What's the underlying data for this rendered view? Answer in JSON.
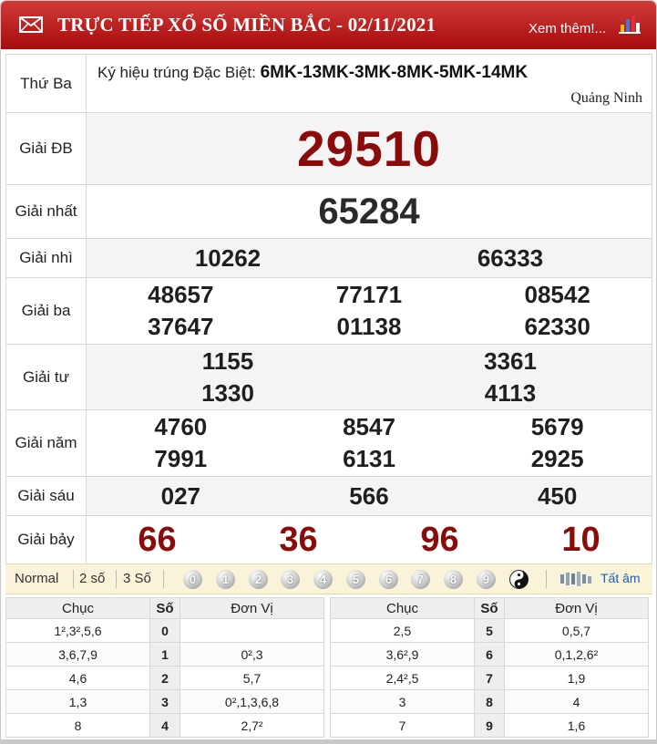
{
  "header": {
    "title": "TRỰC TIẾP XỔ SỐ MIỀN BẮC - 02/11/2021",
    "more_link": "Xem thêm!...",
    "colors": {
      "header_bg": "#b81818",
      "prize_red": "#8b0b0b"
    },
    "icons": [
      "mail-icon",
      "bar-chart-icon"
    ]
  },
  "results": {
    "day": "Thứ Ba",
    "special_code_label": "Ký hiệu trúng Đặc Biệt:",
    "special_code": "6MK-13MK-3MK-8MK-5MK-14MK",
    "province": "Quảng Ninh",
    "prizes": {
      "db": {
        "label": "Giải ĐB",
        "numbers": [
          "29510"
        ]
      },
      "g1": {
        "label": "Giải nhất",
        "numbers": [
          "65284"
        ]
      },
      "g2": {
        "label": "Giải nhì",
        "numbers": [
          "10262",
          "66333"
        ]
      },
      "g3": {
        "label": "Giải ba",
        "numbers": [
          "48657",
          "77171",
          "08542",
          "37647",
          "01138",
          "62330"
        ]
      },
      "g4": {
        "label": "Giải tư",
        "numbers": [
          "1155",
          "3361",
          "1330",
          "4113"
        ]
      },
      "g5": {
        "label": "Giải năm",
        "numbers": [
          "4760",
          "8547",
          "5679",
          "7991",
          "6131",
          "2925"
        ]
      },
      "g6": {
        "label": "Giải sáu",
        "numbers": [
          "027",
          "566",
          "450"
        ]
      },
      "g7": {
        "label": "Giải bảy",
        "numbers": [
          "66",
          "36",
          "96",
          "10"
        ]
      }
    }
  },
  "toolbar": {
    "normal": "Normal",
    "two_digits": "2 số",
    "three_digits": "3 Số",
    "digits": [
      "0",
      "1",
      "2",
      "3",
      "4",
      "5",
      "6",
      "7",
      "8",
      "9"
    ],
    "icons": [
      "yin-yang-icon",
      "sound-icon"
    ],
    "tat_am": "Tất âm"
  },
  "loto": {
    "headers": {
      "chuc": "Chục",
      "so": "Số",
      "donvi": "Đơn Vị"
    },
    "left": [
      {
        "chuc": "1²,3²,5,6",
        "so": "0",
        "donvi": ""
      },
      {
        "chuc": "3,6,7,9",
        "so": "1",
        "donvi": "0²,3"
      },
      {
        "chuc": "4,6",
        "so": "2",
        "donvi": "5,7"
      },
      {
        "chuc": "1,3",
        "so": "3",
        "donvi": "0²,1,3,6,8"
      },
      {
        "chuc": "8",
        "so": "4",
        "donvi": "2,7²"
      }
    ],
    "right": [
      {
        "chuc": "2,5",
        "so": "5",
        "donvi": "0,5,7"
      },
      {
        "chuc": "3,6²,9",
        "so": "6",
        "donvi": "0,1,2,6²"
      },
      {
        "chuc": "2,4²,5",
        "so": "7",
        "donvi": "1,9"
      },
      {
        "chuc": "3",
        "so": "8",
        "donvi": "4"
      },
      {
        "chuc": "7",
        "so": "9",
        "donvi": "1,6"
      }
    ]
  }
}
